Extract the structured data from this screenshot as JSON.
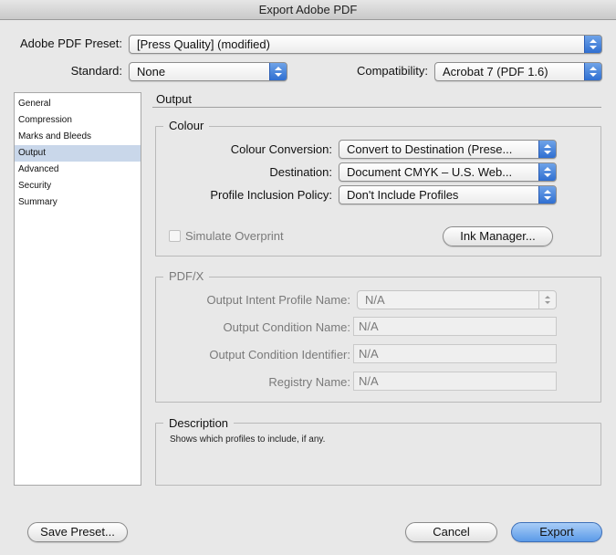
{
  "window": {
    "title": "Export Adobe PDF"
  },
  "header": {
    "preset_label": "Adobe PDF Preset:",
    "preset_value": "[Press Quality] (modified)",
    "standard_label": "Standard:",
    "standard_value": "None",
    "compat_label": "Compatibility:",
    "compat_value": "Acrobat 7 (PDF 1.6)"
  },
  "sidebar": {
    "items": [
      {
        "label": "General"
      },
      {
        "label": "Compression"
      },
      {
        "label": "Marks and Bleeds"
      },
      {
        "label": "Output",
        "selected": true
      },
      {
        "label": "Advanced"
      },
      {
        "label": "Security"
      },
      {
        "label": "Summary"
      }
    ]
  },
  "panel": {
    "title": "Output"
  },
  "colour": {
    "title": "Colour",
    "conversion_label": "Colour Conversion:",
    "conversion_value": "Convert to Destination (Prese...",
    "destination_label": "Destination:",
    "destination_value": "Document CMYK – U.S. Web...",
    "policy_label": "Profile Inclusion Policy:",
    "policy_value": "Don't Include Profiles",
    "simulate_label": "Simulate Overprint",
    "simulate_checked": false,
    "ink_manager_label": "Ink Manager..."
  },
  "pdfx": {
    "title": "PDF/X",
    "intent_label": "Output Intent Profile Name:",
    "intent_value": "N/A",
    "condition_label": "Output Condition Name:",
    "condition_value": "N/A",
    "identifier_label": "Output Condition Identifier:",
    "identifier_value": "N/A",
    "registry_label": "Registry Name:",
    "registry_value": "N/A"
  },
  "description": {
    "title": "Description",
    "text": "Shows which profiles to include, if any."
  },
  "footer": {
    "save_preset_label": "Save Preset...",
    "cancel_label": "Cancel",
    "export_label": "Export"
  },
  "colors": {
    "accent": "#3d7be0",
    "selection": "#c9d7ea"
  }
}
